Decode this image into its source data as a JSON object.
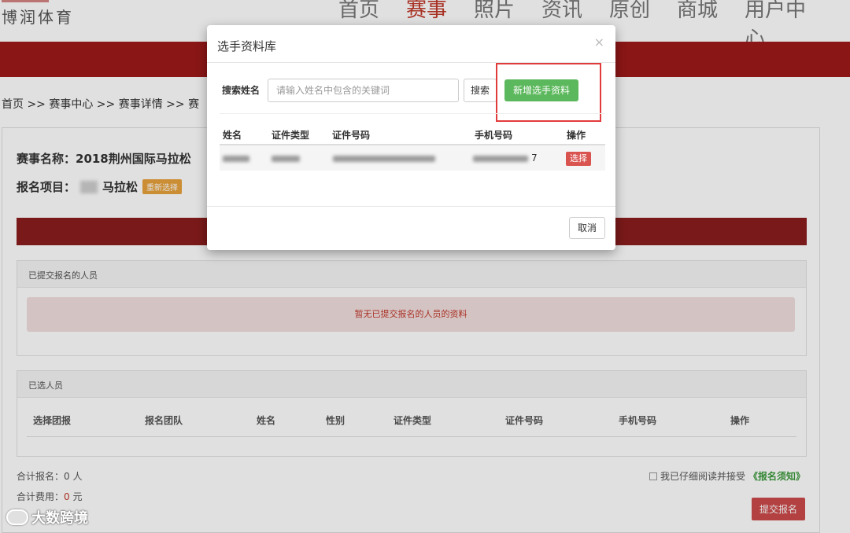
{
  "header": {
    "logo": "博润体育",
    "nav": [
      "首页",
      "赛事",
      "照片",
      "资讯",
      "原创",
      "商城",
      "用户中心"
    ],
    "active_index": 1
  },
  "breadcrumb": "首页 >> 赛事中心 >> 赛事详情 >> 赛",
  "event": {
    "name": "赛事名称：2018荆州国际马拉松",
    "item_prefix": "报名项目：",
    "item_suffix": "马拉松",
    "reselect_label": "重新选择"
  },
  "submitted": {
    "title": "已提交报名的人员",
    "empty_text": "暂无已提交报名的人员的资料"
  },
  "selected": {
    "title": "已选人员",
    "columns": [
      "选择团报",
      "报名团队",
      "姓名",
      "性别",
      "证件类型",
      "证件号码",
      "手机号码",
      "操作"
    ]
  },
  "totals": {
    "count_label": "合计报名：0 人",
    "fee_prefix": "合计费用：",
    "fee_value": "0",
    "fee_suffix": " 元"
  },
  "agreement": {
    "text": "我已仔细阅读并接受",
    "link": "《报名须知》"
  },
  "submit_label": "提交报名",
  "modal": {
    "title": "选手资料库",
    "close_glyph": "×",
    "search_label": "搜索姓名",
    "search_placeholder": "请输入姓名中包含的关键词",
    "search_button": "搜索",
    "add_button": "新增选手资料",
    "columns": [
      "姓名",
      "证件类型",
      "证件号码",
      "手机号码",
      "操作"
    ],
    "row": {
      "phone_tail": "7",
      "action": "选择"
    },
    "cancel_button": "取消"
  },
  "watermark": "大数跨境",
  "colors": {
    "brand_red": "#9e1a1a",
    "green": "#5cb85c",
    "danger": "#d9534f",
    "highlight": "#e23b3b"
  }
}
